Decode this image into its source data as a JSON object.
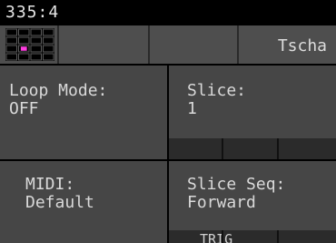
{
  "status": {
    "text": "335:4"
  },
  "toolbar": {
    "title": "Tscha"
  },
  "grid": {
    "rows": 4,
    "cols": 4,
    "active_row": 2,
    "active_col": 1,
    "active_color": "#ff3de0"
  },
  "panels": {
    "loop_mode": {
      "label": "Loop Mode:",
      "value": "OFF"
    },
    "slice": {
      "label": "Slice:",
      "value": "1"
    },
    "midi": {
      "label": "MIDI:",
      "value": "Default"
    },
    "slice_seq": {
      "label": "Slice Seq:",
      "value": "Forward"
    }
  },
  "bottom_strip": {
    "label": "TRIG"
  },
  "colors": {
    "panel": "#464646",
    "toolbar": "#4e4e4e",
    "text": "#d9d9d9"
  }
}
